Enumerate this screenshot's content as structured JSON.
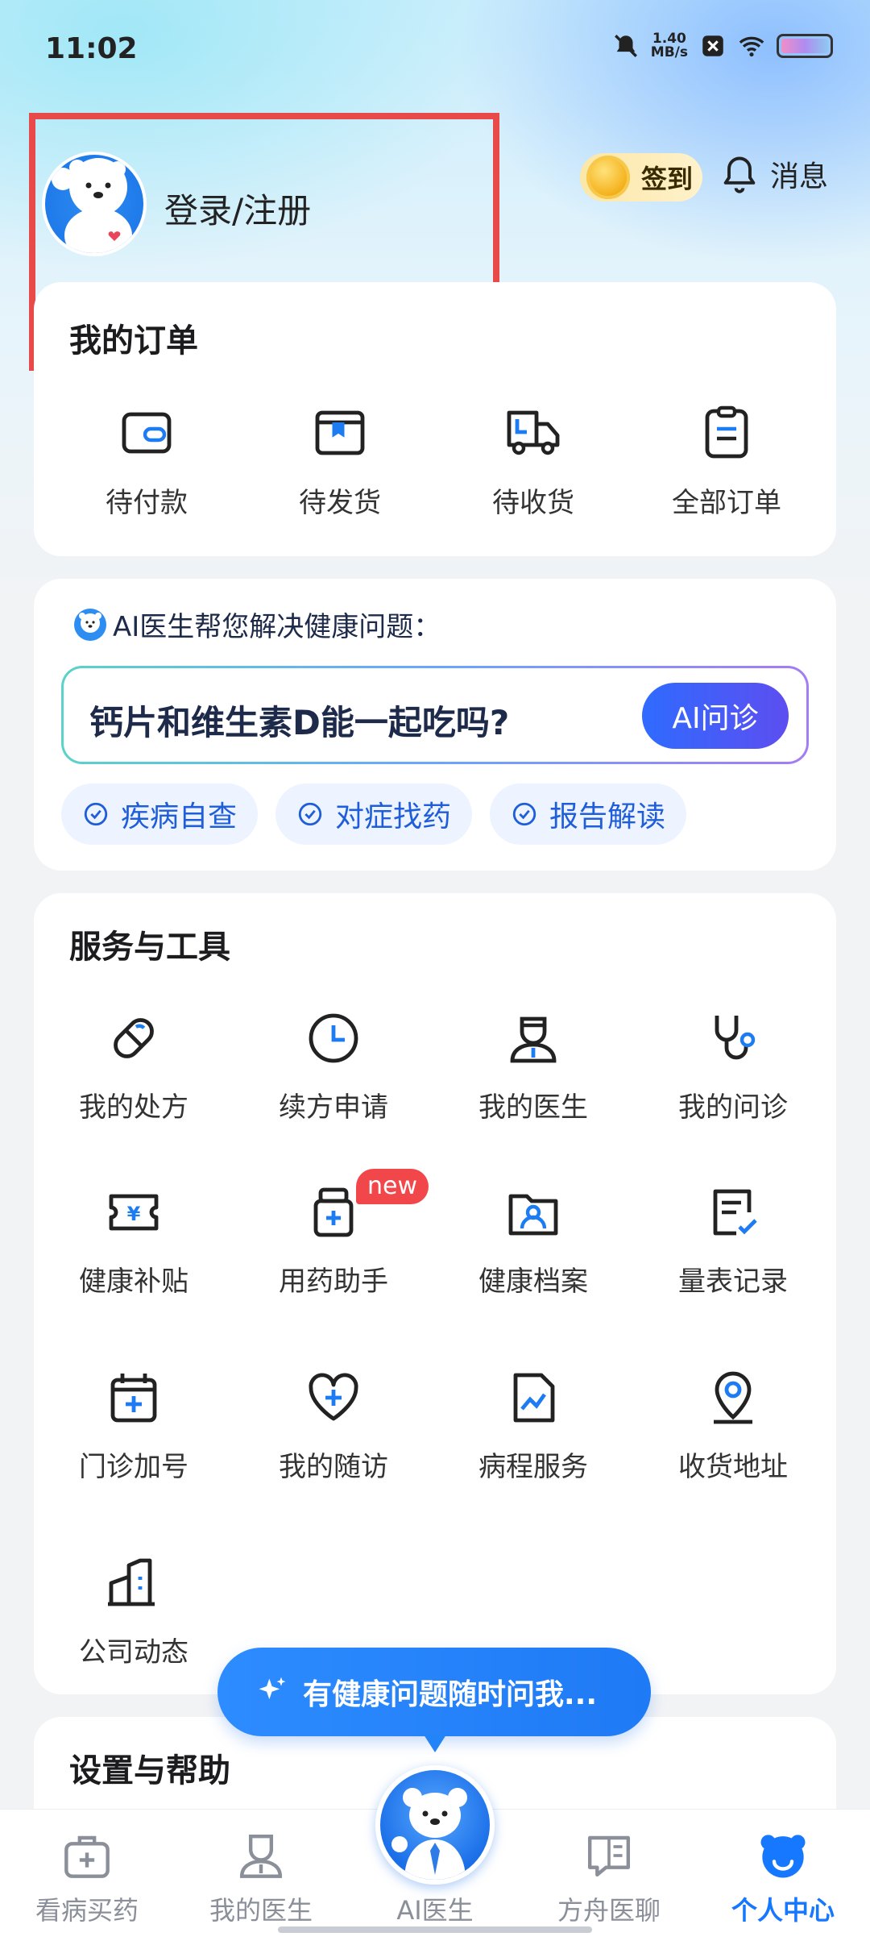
{
  "status_bar": {
    "time": "11:02",
    "net_speed_value": "1.40",
    "net_speed_unit": "MB/s"
  },
  "header": {
    "login_label": "登录/注册",
    "signin_label": "签到",
    "message_label": "消息"
  },
  "orders": {
    "title": "我的订单",
    "items": [
      {
        "label": "待付款",
        "icon": "wallet-icon"
      },
      {
        "label": "待发货",
        "icon": "box-icon"
      },
      {
        "label": "待收货",
        "icon": "truck-icon"
      },
      {
        "label": "全部订单",
        "icon": "clipboard-icon"
      }
    ]
  },
  "ai_card": {
    "heading": "AI医生帮您解决健康问题：",
    "question": "钙片和维生素D能一起吃吗?",
    "button_label": "AI问诊",
    "chips": [
      "疾病自查",
      "对症找药",
      "报告解读"
    ]
  },
  "services": {
    "title": "服务与工具",
    "items": [
      {
        "label": "我的处方",
        "icon": "pill-icon"
      },
      {
        "label": "续方申请",
        "icon": "clock-icon"
      },
      {
        "label": "我的医生",
        "icon": "doctor-icon"
      },
      {
        "label": "我的问诊",
        "icon": "stethoscope-icon"
      },
      {
        "label": "健康补贴",
        "icon": "yuan-ticket-icon"
      },
      {
        "label": "用药助手",
        "icon": "medicine-bottle-icon",
        "badge": "new"
      },
      {
        "label": "健康档案",
        "icon": "folder-user-icon"
      },
      {
        "label": "量表记录",
        "icon": "checklist-icon"
      },
      {
        "label": "门诊加号",
        "icon": "calendar-plus-icon"
      },
      {
        "label": "我的随访",
        "icon": "heart-plus-icon"
      },
      {
        "label": "病程服务",
        "icon": "chart-doc-icon"
      },
      {
        "label": "收货地址",
        "icon": "location-pin-icon"
      },
      {
        "label": "公司动态",
        "icon": "building-icon"
      }
    ]
  },
  "float_prompt": "有健康问题随时问我...",
  "settings": {
    "title": "设置与帮助"
  },
  "tabbar": {
    "items": [
      {
        "label": "看病买药",
        "icon": "medkit-icon",
        "active": false
      },
      {
        "label": "我的医生",
        "icon": "doctor-icon",
        "active": false
      },
      {
        "label": "AI医生",
        "icon": "ai-bear-icon",
        "active": false
      },
      {
        "label": "方舟医聊",
        "icon": "chat-book-icon",
        "active": false
      },
      {
        "label": "个人中心",
        "icon": "bear-face-icon",
        "active": true
      }
    ]
  },
  "colors": {
    "accent": "#1677ff",
    "highlight_border": "#e84a4a",
    "badge_new": "#f2474a"
  }
}
